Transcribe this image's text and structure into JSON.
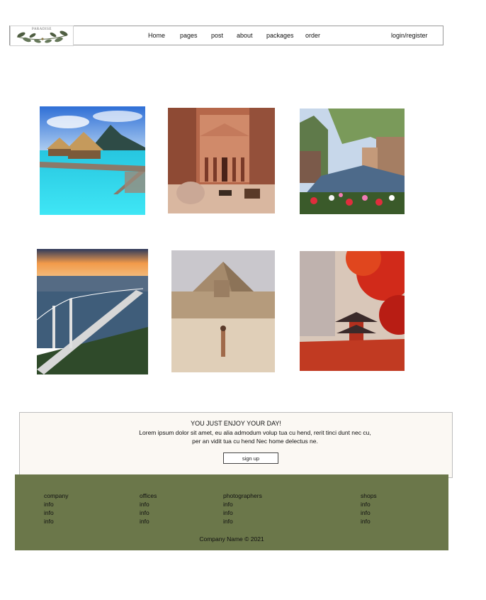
{
  "brand": {
    "logo_text": "PARADISE"
  },
  "nav": {
    "links": [
      "Home",
      "pages",
      "post",
      "about",
      "packages",
      "order"
    ],
    "account": "login/register"
  },
  "gallery": [
    {
      "name": "overwater-bungalows",
      "icon": "tropical-island-photo"
    },
    {
      "name": "petra-treasury",
      "icon": "petra-photo"
    },
    {
      "name": "amsterdam-canal",
      "icon": "canal-photo"
    },
    {
      "name": "istanbul-bridge",
      "icon": "bridge-photo"
    },
    {
      "name": "giza-pyramid",
      "icon": "pyramid-photo"
    },
    {
      "name": "kyoto-pagoda",
      "icon": "pagoda-photo"
    }
  ],
  "promo": {
    "title": "YOU JUST ENJOY YOUR DAY!",
    "body": "Lorem ipsum dolor sit amet, eu alia admodum volup tua cu hend, rerit tinci dunt nec cu, per an vidit tua cu hend Nec home delectus ne.",
    "button": "sign up"
  },
  "footer": {
    "columns": [
      {
        "heading": "company",
        "items": [
          "info",
          "info",
          "info"
        ]
      },
      {
        "heading": "offices",
        "items": [
          "info",
          "info",
          "info"
        ]
      },
      {
        "heading": "photographers",
        "items": [
          "info",
          "info",
          "info"
        ]
      },
      {
        "heading": "shops",
        "items": [
          "info",
          "info",
          "info"
        ]
      }
    ],
    "copyright": "Company Name © 2021"
  },
  "colors": {
    "footer_bg": "#6b774a",
    "promo_bg": "#fbf8f3"
  }
}
